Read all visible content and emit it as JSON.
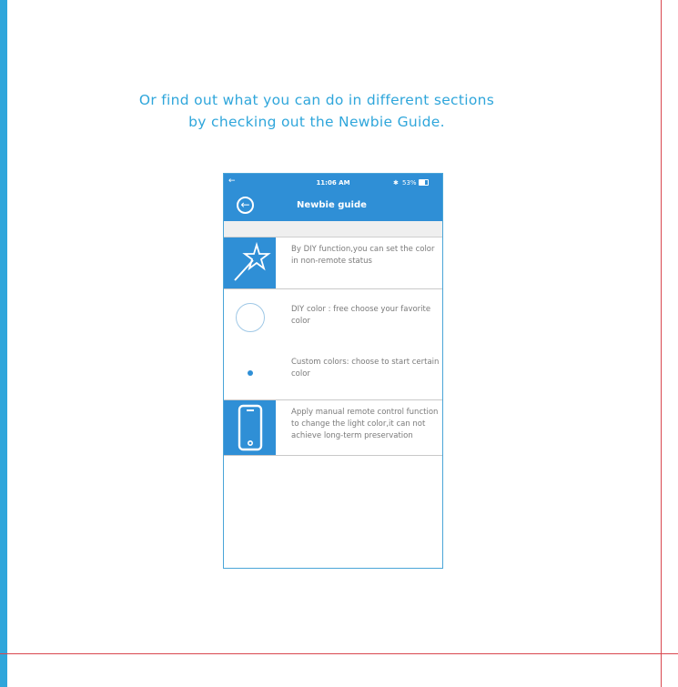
{
  "heading": {
    "line1": "Or find out what you can do in different sections",
    "line2": "by checking out the Newbie Guide."
  },
  "phone": {
    "status_time": "11:06 AM",
    "status_battery": "53%",
    "back_arrow": "←",
    "nav_title": "Newbie guide",
    "items": [
      {
        "icon": "magic-wand-icon",
        "text": "By DIY function,you can set the color  in non-remote status"
      },
      {
        "icon": "circle-icon",
        "text": "DIY color : free choose your favorite color"
      },
      {
        "icon": "dot-icon",
        "text": "Custom colors: choose to start certain color"
      },
      {
        "icon": "smartphone-icon",
        "text": "Apply manual remote control function to change the light color,it can not achieve long-term preservation"
      }
    ]
  },
  "colors": {
    "accent": "#2fa6db",
    "app_blue": "#2f8fd6",
    "trim": "#d9474f"
  }
}
